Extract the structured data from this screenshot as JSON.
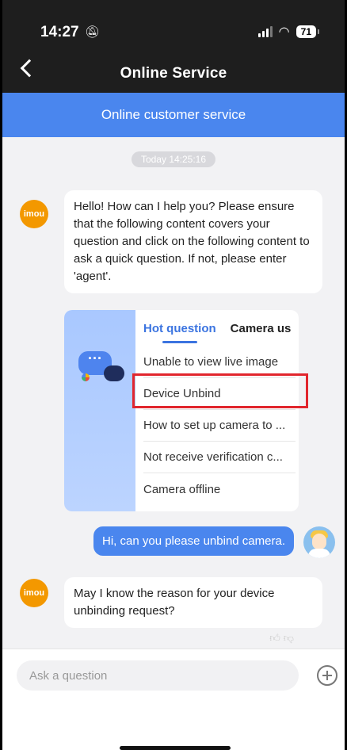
{
  "status": {
    "time": "14:27",
    "battery": "71"
  },
  "header": {
    "title": "Online Service"
  },
  "banner": {
    "label": "Online customer service"
  },
  "chat": {
    "timestamp": "Today 14:25:16",
    "bot_avatar_label": "imou",
    "messages": [
      "Hello! How can I help you? Please ensure that the following content covers your question and click on the following content to ask a quick question. If not, please enter 'agent'.",
      "May I know the reason for your device unbinding request?"
    ],
    "card": {
      "tabs": [
        "Hot question",
        "Camera us"
      ],
      "questions": [
        "Unable to view live image",
        "Device Unbind",
        "How to set up camera to ...",
        "Not receive verification c...",
        "Camera offline"
      ]
    },
    "user_message": "Hi, can you please unbind camera."
  },
  "input": {
    "placeholder": "Ask a question"
  },
  "icons": {
    "back": "chevron-left-icon",
    "add": "plus-circle-icon",
    "mute": "bell-slash-icon"
  },
  "colors": {
    "accent": "#4a86ee",
    "bot_avatar": "#f39800",
    "highlight": "#e1262d",
    "header": "#1e1e1e"
  }
}
